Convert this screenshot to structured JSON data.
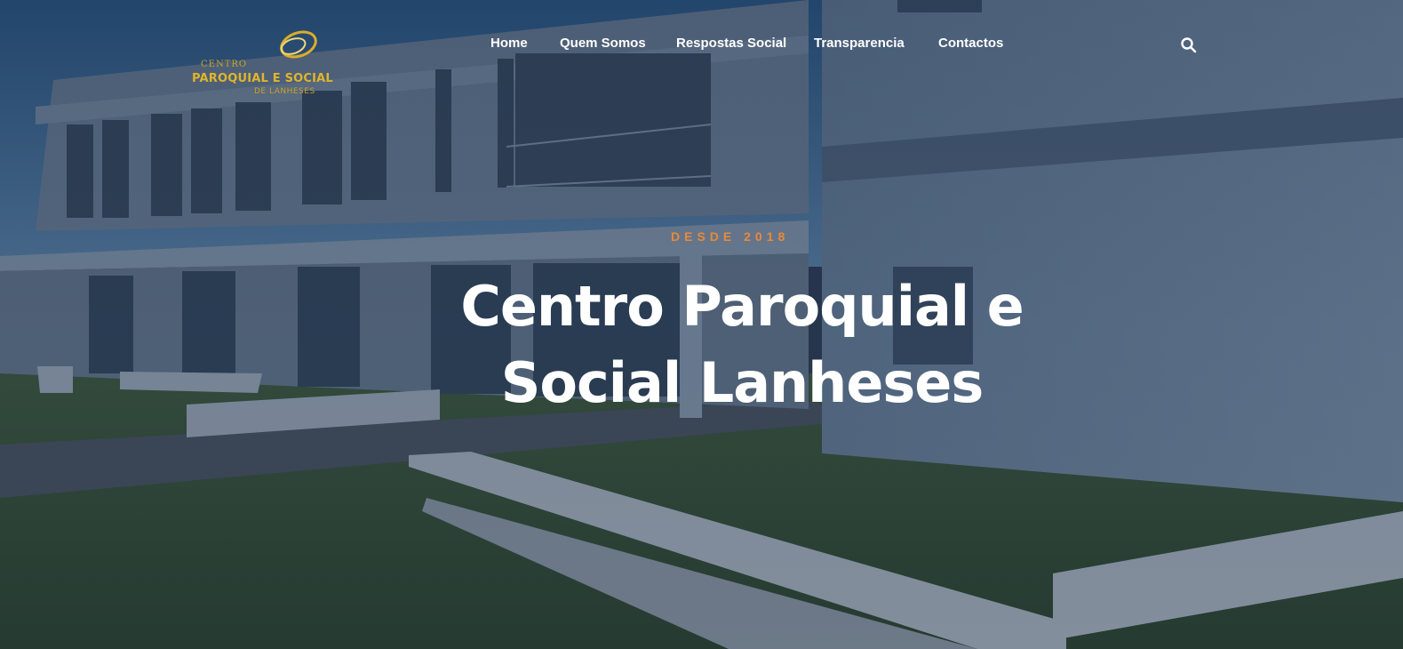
{
  "header": {
    "logo": {
      "line1": "CENTRO",
      "line2": "PAROQUIAL E SOCIAL",
      "line3": "DE LANHESES"
    },
    "nav": [
      {
        "label": "Home"
      },
      {
        "label": "Quem Somos"
      },
      {
        "label": "Respostas Social"
      },
      {
        "label": "Transparencia"
      },
      {
        "label": "Contactos"
      }
    ],
    "search_icon": "search-icon"
  },
  "hero": {
    "kicker": "DESDE 2018",
    "title_line1": "Centro Paroquial e",
    "title_line2": "Social Lanheses"
  },
  "colors": {
    "accent": "#e8893a",
    "logo_gold": "#e0b52c",
    "overlay": "#142442",
    "text": "#ffffff"
  }
}
